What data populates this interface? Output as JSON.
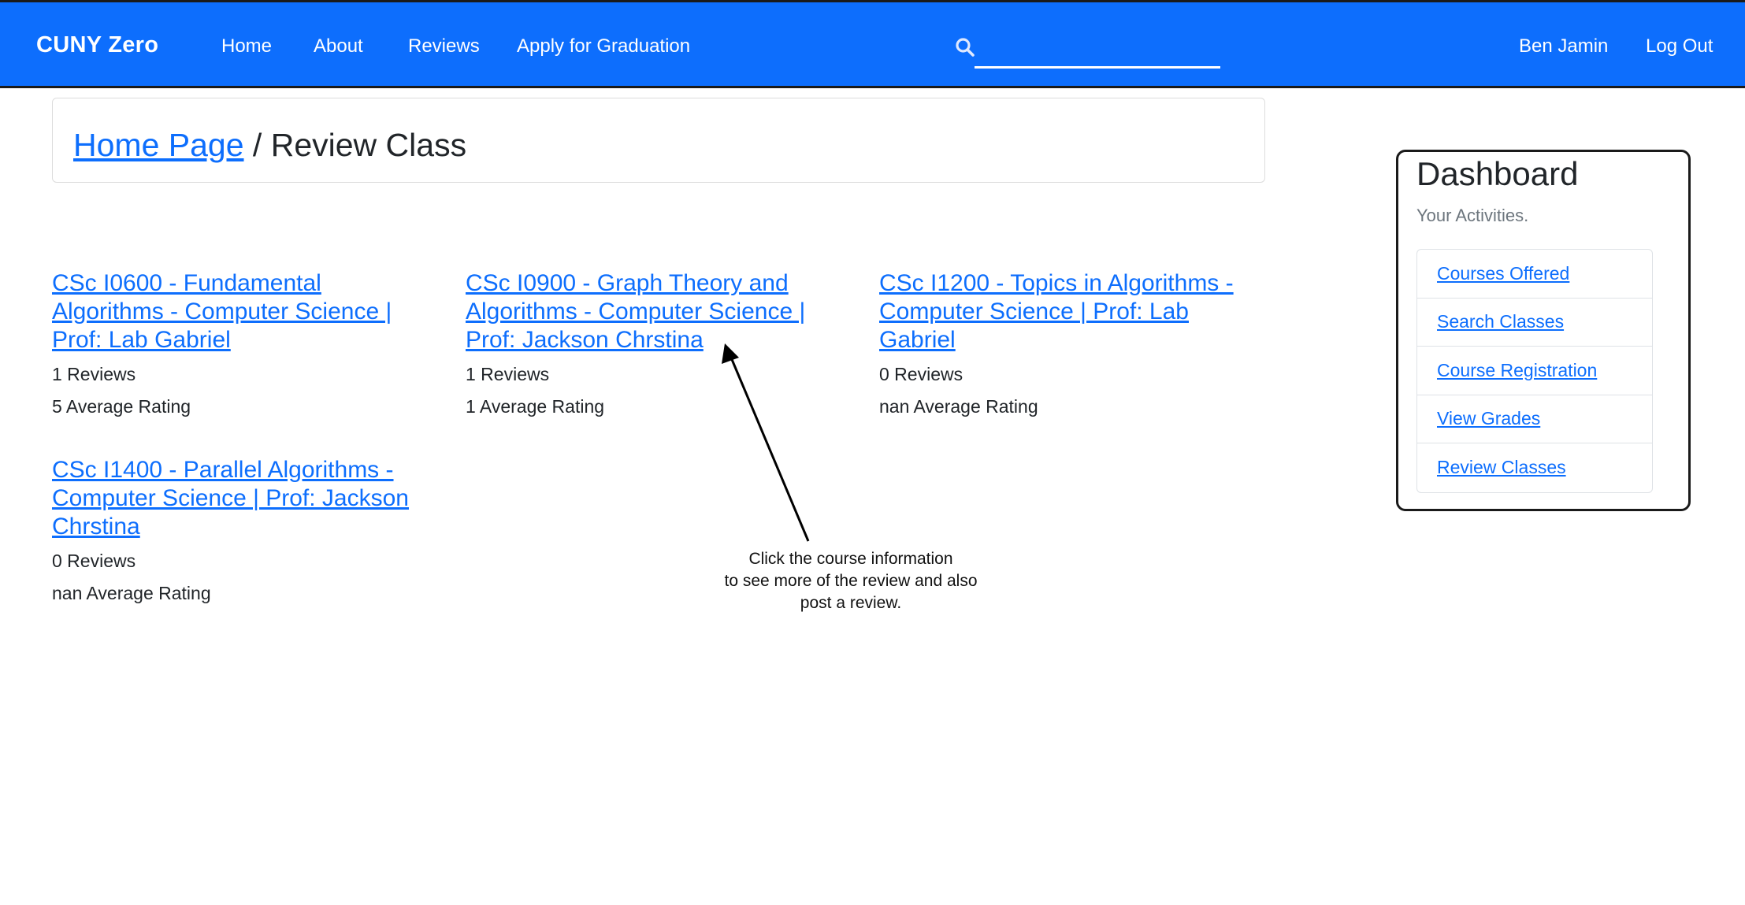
{
  "navbar": {
    "brand": "CUNY Zero",
    "links": [
      {
        "label": "Home"
      },
      {
        "label": "About"
      },
      {
        "label": "Reviews"
      },
      {
        "label": "Apply for Graduation"
      }
    ],
    "search": {
      "placeholder": "",
      "value": "",
      "icon": "search-icon"
    },
    "user_name": "Ben Jamin",
    "logout_label": "Log Out"
  },
  "breadcrumb": {
    "home_label": "Home Page",
    "separator": "/",
    "current": "Review Class"
  },
  "courses": [
    {
      "title": "CSc I0600 - Fundamental Algorithms - Computer Science | Prof: Lab Gabriel",
      "reviews": "1 Reviews",
      "rating": "5 Average Rating"
    },
    {
      "title": "CSc I0900 - Graph Theory and Algorithms - Computer Science | Prof: Jackson Chrstina",
      "reviews": "1 Reviews",
      "rating": "1 Average Rating"
    },
    {
      "title": "CSc I1200 - Topics in Algorithms - Computer Science | Prof: Lab Gabriel",
      "reviews": "0 Reviews",
      "rating": "nan Average Rating"
    },
    {
      "title": "CSc I1400 - Parallel Algorithms - Computer Science | Prof: Jackson Chrstina",
      "reviews": "0 Reviews",
      "rating": "nan Average Rating"
    }
  ],
  "annotation": {
    "line1": "Click the course information",
    "line2": "to see more of the review and also",
    "line3": "post a review."
  },
  "dashboard": {
    "title": "Dashboard",
    "subtitle": "Your Activities.",
    "items": [
      {
        "label": "Courses Offered"
      },
      {
        "label": "Search Classes"
      },
      {
        "label": "Course Registration"
      },
      {
        "label": "View Grades"
      },
      {
        "label": "Review Classes"
      }
    ]
  },
  "colors": {
    "primary": "#0d6efd",
    "link": "#0d6efd",
    "text": "#212529",
    "muted": "#6c757d"
  }
}
